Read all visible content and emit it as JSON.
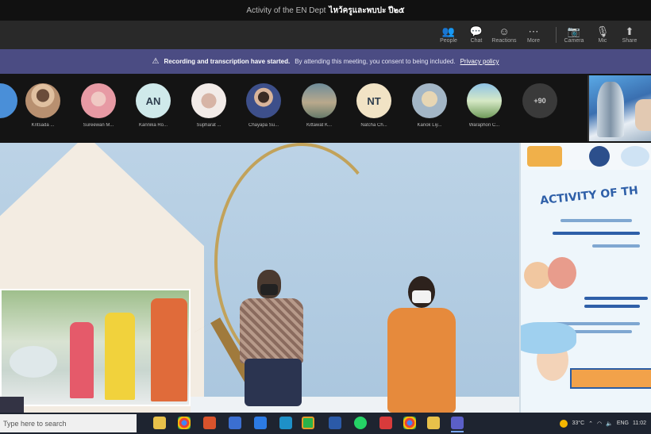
{
  "titlebar": {
    "prefix": "Activity of the EN Dept",
    "title": "ไหว้ครูและพบปะ ปี๒๕"
  },
  "toolbar": {
    "buttons": [
      {
        "name": "people",
        "label": "People",
        "icon": "people-icon"
      },
      {
        "name": "chat",
        "label": "Chat",
        "icon": "chat-icon"
      },
      {
        "name": "reactions",
        "label": "Reactions",
        "icon": "reactions-icon"
      },
      {
        "name": "more",
        "label": "More",
        "icon": "more-icon"
      },
      {
        "name": "camera",
        "label": "Camera",
        "icon": "camera-icon"
      },
      {
        "name": "mic",
        "label": "Mic",
        "icon": "mic-icon"
      },
      {
        "name": "share",
        "label": "Share",
        "icon": "share-icon"
      }
    ]
  },
  "banner": {
    "bold": "Recording and transcription have started.",
    "text": "By attending this meeting, you consent to being included.",
    "link": "Privacy policy"
  },
  "participants": [
    {
      "name": "",
      "initials": "",
      "color": "#4a8fd8"
    },
    {
      "name": "Kritsada ...",
      "initials": "",
      "color": "#c9a37e"
    },
    {
      "name": "Sureewan M...",
      "initials": "",
      "color": "#e9b4b9"
    },
    {
      "name": "Kannika Ro...",
      "initials": "AN",
      "color": "#cfe9ea"
    },
    {
      "name": "Supharat ...",
      "initials": "",
      "color": "#e7d3cb"
    },
    {
      "name": "Chayapa Su...",
      "initials": "",
      "color": "#c7a98f"
    },
    {
      "name": "Kittawat K...",
      "initials": "",
      "color": "#8fa2a8"
    },
    {
      "name": "Natcha Ch...",
      "initials": "NT",
      "color": "#f1e3c5"
    },
    {
      "name": "Kanok Liy...",
      "initials": "",
      "color": "#cdb27d"
    },
    {
      "name": "Waraphon C...",
      "initials": "",
      "color": "#9fc0a9"
    },
    {
      "name": "",
      "initials": "+90",
      "color": "#3a3a3a"
    }
  ],
  "stage": {
    "poster_title": "ACTIVITY OF TH",
    "corner_label": ""
  },
  "taskbar": {
    "search_placeholder": "Type here to search",
    "apps": [
      "file-explorer-icon",
      "chrome-icon",
      "office-icon",
      "store-icon",
      "mail-icon",
      "edge-icon",
      "line-icon",
      "word-icon",
      "whatsapp-icon",
      "acrobat-icon",
      "chrome2-icon",
      "folder-icon",
      "teams-icon"
    ],
    "weather": "33°C",
    "lang": "ENG",
    "clock": "11:02"
  }
}
